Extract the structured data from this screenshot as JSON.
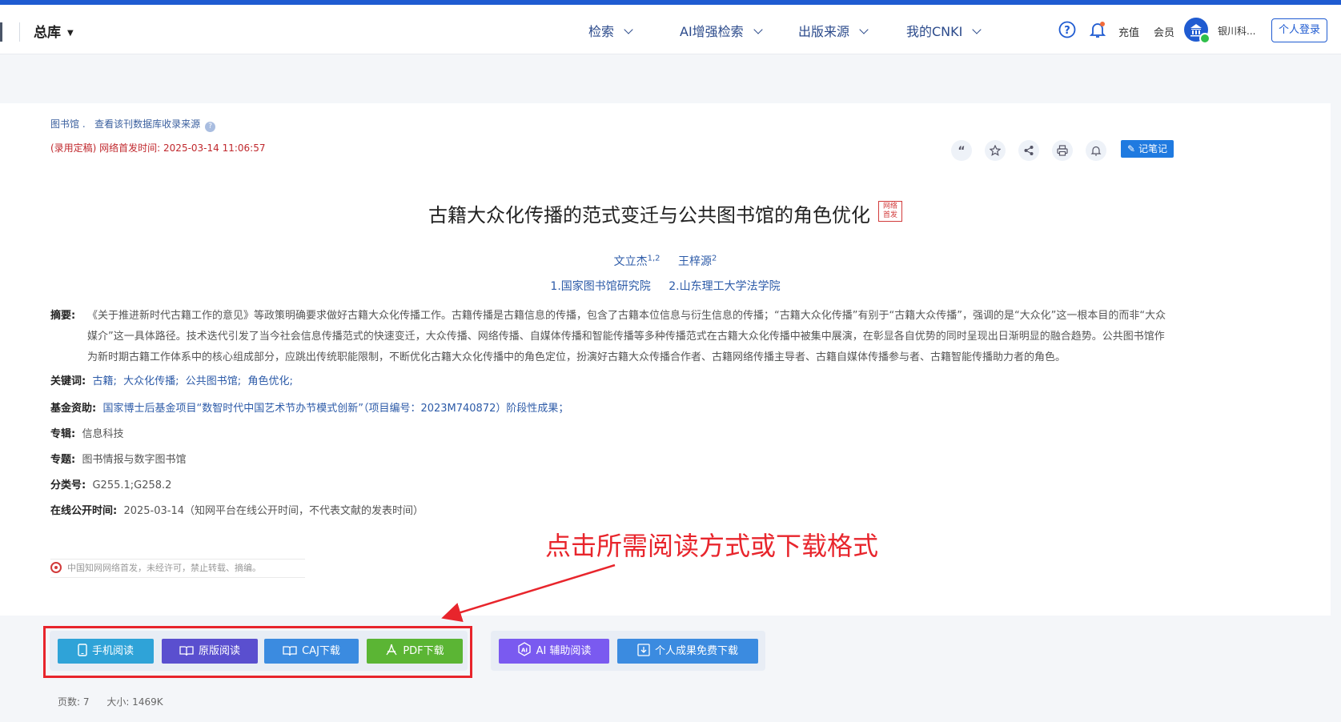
{
  "header": {
    "library": "总库",
    "nav": [
      {
        "label": "检索"
      },
      {
        "label": "AI增强检索"
      },
      {
        "label": "出版来源"
      },
      {
        "label": "我的CNKI"
      }
    ],
    "recharge": "充值",
    "member": "会员",
    "org": "银川科...",
    "login": "个人登录"
  },
  "article": {
    "source_prefix": "图书馆 .",
    "source_link": "查看该刊数据库收录来源",
    "pub_status": "(录用定稿) 网络首发时间: 2025-03-14 11:06:57",
    "note_button": "记笔记",
    "title": "古籍大众化传播的范式变迁与公共图书馆的角色优化",
    "title_badge": "网络首发",
    "authors": [
      {
        "name": "文立杰",
        "sup": "1,2"
      },
      {
        "name": "王梓源",
        "sup": "2"
      }
    ],
    "affiliations": [
      "1.国家图书馆研究院",
      "2.山东理工大学法学院"
    ],
    "abstract_label": "摘要:",
    "abstract": "《关于推进新时代古籍工作的意见》等政策明确要求做好古籍大众化传播工作。古籍传播是古籍信息的传播，包含了古籍本位信息与衍生信息的传播；“古籍大众化传播”有别于“古籍大众传播”，强调的是“大众化”这一根本目的而非“大众媒介”这一具体路径。技术迭代引发了当今社会信息传播范式的快速变迁，大众传播、网络传播、自媒体传播和智能传播等多种传播范式在古籍大众化传播中被集中展演，在彰显各自优势的同时呈现出日渐明显的融合趋势。公共图书馆作为新时期古籍工作体系中的核心组成部分，应跳出传统职能限制，不断优化古籍大众化传播中的角色定位，扮演好古籍大众传播合作者、古籍网络传播主导者、古籍自媒体传播参与者、古籍智能传播助力者的角色。",
    "keywords_label": "关键词:",
    "keywords": [
      "古籍;",
      "大众化传播;",
      "公共图书馆;",
      "角色优化;"
    ],
    "fund_label": "基金资助:",
    "fund": "国家博士后基金项目“数智时代中国艺术节办节模式创新”（项目编号：2023M740872）阶段性成果；",
    "series_label": "专辑:",
    "series": "信息科技",
    "topic_label": "专题:",
    "topic": "图书情报与数字图书馆",
    "class_label": "分类号:",
    "class_no": "G255.1;G258.2",
    "online_label": "在线公开时间:",
    "online_time": "2025-03-14（知网平台在线公开时间，不代表文献的发表时间）",
    "copyright": "中国知网网络首发，未经许可，禁止转载、摘编。"
  },
  "annotation": "点击所需阅读方式或下载格式",
  "buttons": {
    "mobile": "手机阅读",
    "original": "原版阅读",
    "caj": "CAJ下载",
    "pdf": "PDF下载",
    "ai": "AI 辅助阅读",
    "personal": "个人成果免费下载"
  },
  "meta": {
    "pages": "页数: 7",
    "size": "大小: 1469K"
  },
  "colors": {
    "mobile": "#2fa3d8",
    "original": "#5a4fcf",
    "caj": "#3b8be0",
    "pdf": "#5bb534",
    "ai": "#7a5af0",
    "personal": "#3b8be0",
    "annotation": "#e8252c"
  }
}
